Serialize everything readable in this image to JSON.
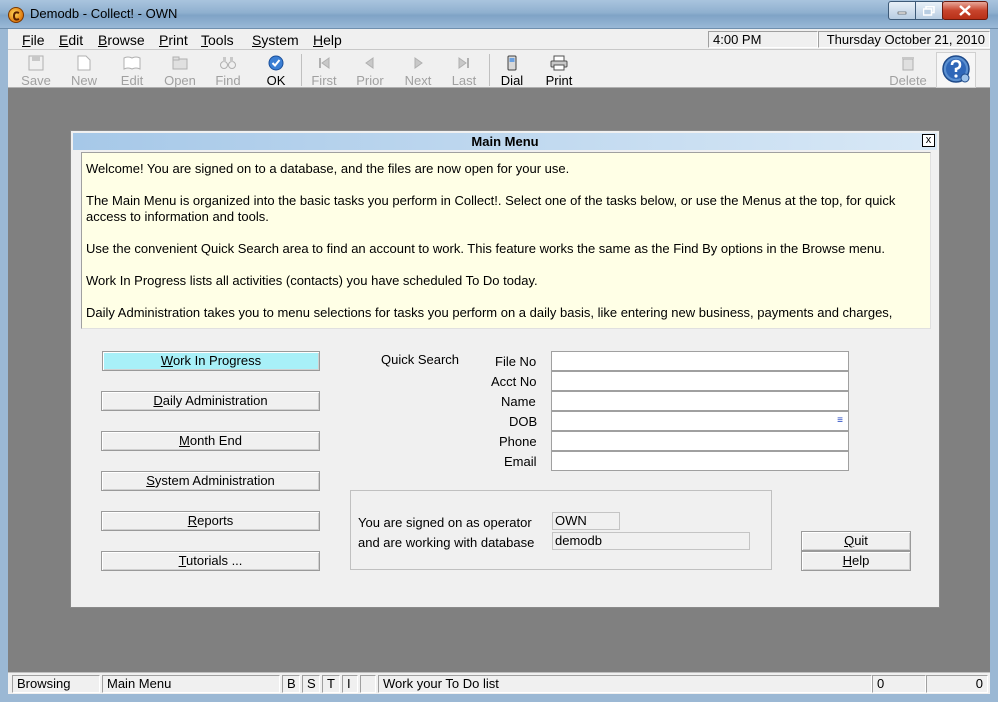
{
  "window": {
    "title": "Demodb - Collect! - OWN"
  },
  "menu": {
    "items": [
      {
        "u": "F",
        "rest": "ile"
      },
      {
        "u": "E",
        "rest": "dit"
      },
      {
        "u": "B",
        "rest": "rowse"
      },
      {
        "u": "P",
        "rest": "rint"
      },
      {
        "u": "T",
        "rest": "ools"
      },
      {
        "u": "S",
        "rest": "ystem"
      },
      {
        "u": "H",
        "rest": "elp"
      }
    ],
    "time": "4:00 PM",
    "date": "Thursday  October 21, 2010"
  },
  "toolbar": {
    "save": "Save",
    "new": "New",
    "edit": "Edit",
    "open": "Open",
    "find": "Find",
    "ok": "OK",
    "first": "First",
    "prior": "Prior",
    "next": "Next",
    "last": "Last",
    "dial": "Dial",
    "print": "Print",
    "delete": "Delete"
  },
  "dialog": {
    "title": "Main Menu",
    "close": "x",
    "welcome": [
      "Welcome! You are signed on to a database, and the files are now open for your use.",
      "The Main Menu is organized into the basic tasks you perform in Collect!. Select one of the tasks below, or use the Menus at the top, for quick access to information and tools.",
      "Use the convenient Quick Search area to find an account to work. This feature works the same as the Find By options in the Browse menu.",
      "Work In Progress lists all activities (contacts) you have scheduled To Do today.",
      "Daily Administration takes you to menu selections for tasks you perform on a daily basis, like entering new business, payments and charges,"
    ],
    "nav": [
      {
        "u": "W",
        "rest": "ork In Progress"
      },
      {
        "u": "D",
        "rest": "aily Administration"
      },
      {
        "u": "M",
        "rest": "onth End"
      },
      {
        "u": "S",
        "rest": "ystem Administration"
      },
      {
        "u": "R",
        "rest": "eports"
      },
      {
        "u": "T",
        "rest": "utorials ..."
      }
    ],
    "quick_search": {
      "label": "Quick Search",
      "fields": [
        {
          "label": "File No",
          "value": ""
        },
        {
          "label": "Acct No",
          "value": ""
        },
        {
          "label": "Name",
          "value": ""
        },
        {
          "label": "DOB",
          "value": ""
        },
        {
          "label": "Phone",
          "value": ""
        },
        {
          "label": "Email",
          "value": ""
        }
      ]
    },
    "operator_label": "You are signed on as operator",
    "operator": "OWN",
    "database_label": "and are working with database",
    "database": "demodb",
    "quit": {
      "u": "Q",
      "rest": "uit"
    },
    "help": {
      "u": "H",
      "rest": "elp"
    }
  },
  "status": {
    "mode": "Browsing",
    "screen": "Main Menu",
    "flags": [
      "B",
      "S",
      "T",
      "I"
    ],
    "message": "Work your To Do list",
    "count1": "0",
    "count2": "0"
  }
}
